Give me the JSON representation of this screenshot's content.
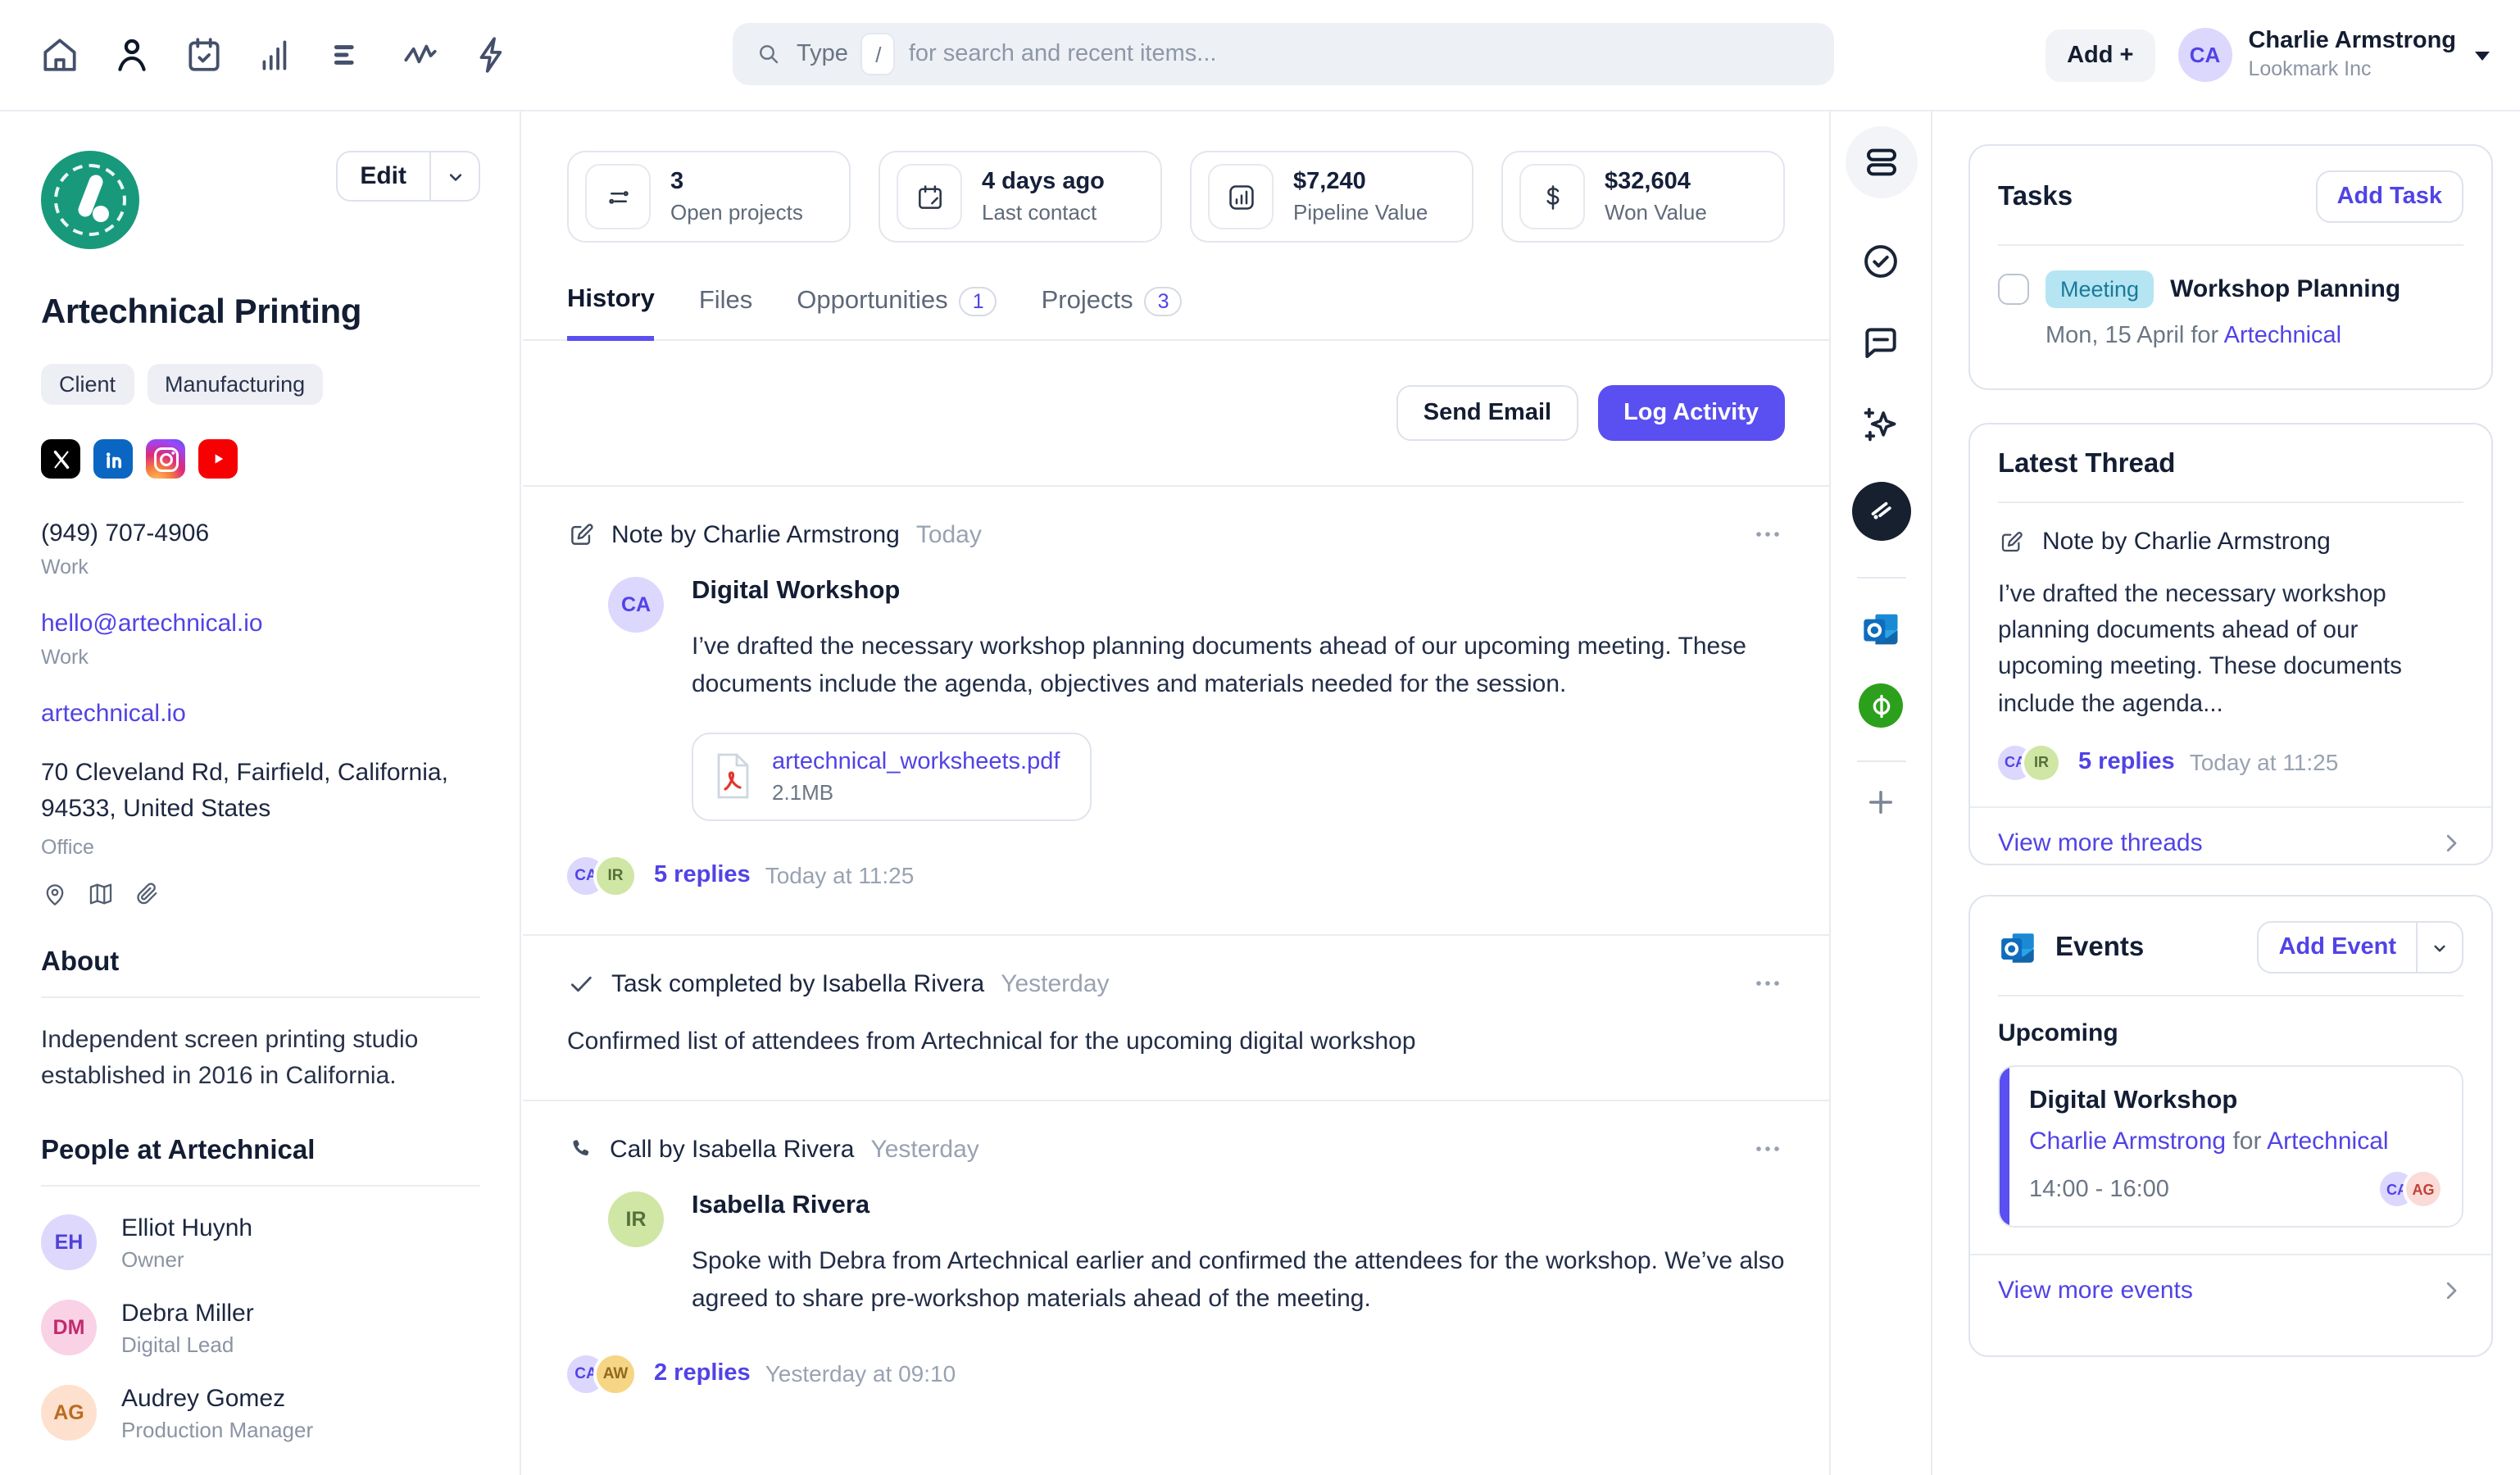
{
  "colors": {
    "accent_link": "#5143e6",
    "accent_button": "#5a4ff0",
    "logo_green": "#18997c",
    "meeting_badge_bg": "#b5e5f2",
    "meeting_badge_text": "#1a7a99"
  },
  "topbar": {
    "nav_icons": [
      "home",
      "contacts",
      "calendar",
      "reports",
      "lists",
      "activity",
      "automations"
    ],
    "search": {
      "prefix": "Type",
      "shortcut": "/",
      "suffix": "for search and recent items..."
    },
    "add_button": "Add +",
    "user": {
      "initials": "CA",
      "name": "Charlie Armstrong",
      "org": "Lookmark Inc"
    }
  },
  "sidebar": {
    "edit_button": "Edit",
    "company_name": "Artechnical Printing",
    "tags": [
      "Client",
      "Manufacturing"
    ],
    "social_icons": [
      "x",
      "linkedin",
      "instagram",
      "youtube"
    ],
    "phone": {
      "value": "(949) 707-4906",
      "label": "Work"
    },
    "email": {
      "value": "hello@artechnical.io",
      "label": "Work"
    },
    "website": "artechnical.io",
    "address": {
      "value": "70 Cleveland Rd, Fairfield, California, 94533, United States",
      "label": "Office"
    },
    "address_icons": [
      "location-pin",
      "map",
      "paperclip"
    ],
    "about": {
      "heading": "About",
      "text": "Independent screen printing studio established in 2016 in California."
    },
    "people": {
      "heading": "People at Artechnical",
      "items": [
        {
          "initials": "EH",
          "name": "Elliot Huynh",
          "role": "Owner"
        },
        {
          "initials": "DM",
          "name": "Debra Miller",
          "role": "Digital Lead"
        },
        {
          "initials": "AG",
          "name": "Audrey Gomez",
          "role": "Production Manager"
        }
      ]
    }
  },
  "main": {
    "stats": [
      {
        "value": "3",
        "label": "Open projects",
        "icon": "filter-lines"
      },
      {
        "value": "4 days ago",
        "label": "Last contact",
        "icon": "calendar"
      },
      {
        "value": "$7,240",
        "label": "Pipeline Value",
        "icon": "bar-chart"
      },
      {
        "value": "$32,604",
        "label": "Won Value",
        "icon": "dollar"
      }
    ],
    "tabs": [
      {
        "label": "History"
      },
      {
        "label": "Files"
      },
      {
        "label": "Opportunities",
        "count": "1"
      },
      {
        "label": "Projects",
        "count": "3"
      }
    ],
    "actions": {
      "send_email": "Send Email",
      "log_activity": "Log Activity"
    },
    "note": {
      "header": "Note by Charlie Armstrong",
      "time": "Today",
      "author_initials": "CA",
      "title": "Digital Workshop",
      "body": "I’ve drafted the necessary workshop planning documents ahead of our upcoming meeting. These documents include the agenda, objectives and materials needed for the session.",
      "attachment": {
        "name": "artechnical_worksheets.pdf",
        "size": "2.1MB"
      },
      "replies": {
        "avatars": [
          "CA",
          "IR"
        ],
        "label": "5 replies",
        "time": "Today at 11:25"
      }
    },
    "task": {
      "header": "Task completed by Isabella Rivera",
      "time": "Yesterday",
      "body": "Confirmed list of attendees from Artechnical for the upcoming digital workshop"
    },
    "call": {
      "header": "Call by Isabella Rivera",
      "time": "Yesterday",
      "author_initials": "IR",
      "author": "Isabella Rivera",
      "body": "Spoke with Debra from Artechnical earlier and confirmed the attendees for the workshop. We’ve also agreed to share pre-workshop materials ahead of the meeting.",
      "replies": {
        "avatars": [
          "CA",
          "AW"
        ],
        "label": "2 replies",
        "time": "Yesterday at 09:10"
      }
    }
  },
  "rail": {
    "icons": [
      "stacked-cards",
      "circle-check",
      "comment",
      "sparkles",
      "feed",
      "outlook",
      "quickbooks",
      "add"
    ]
  },
  "right": {
    "tasks": {
      "heading": "Tasks",
      "add_button": "Add Task",
      "item": {
        "badge": "Meeting",
        "title": "Workshop Planning",
        "date": "Mon, 15 April",
        "for_word": "for",
        "company": "Artechnical"
      }
    },
    "thread": {
      "heading": "Latest Thread",
      "note_header": "Note by Charlie Armstrong",
      "body": "I’ve drafted the necessary workshop planning documents ahead of our upcoming meeting. These documents include the agenda...",
      "replies": {
        "avatars": [
          "CA",
          "IR"
        ],
        "label": "5 replies",
        "time": "Today at 11:25"
      },
      "view_more": "View more threads"
    },
    "events": {
      "heading": "Events",
      "add_button": "Add Event",
      "upcoming_label": "Upcoming",
      "event": {
        "title": "Digital Workshop",
        "organizer": "Charlie Armstrong",
        "for_word": "for",
        "company": "Artechnical",
        "time": "14:00 - 16:00",
        "avatars": [
          "CA",
          "AG"
        ]
      },
      "view_more": "View more events"
    }
  }
}
